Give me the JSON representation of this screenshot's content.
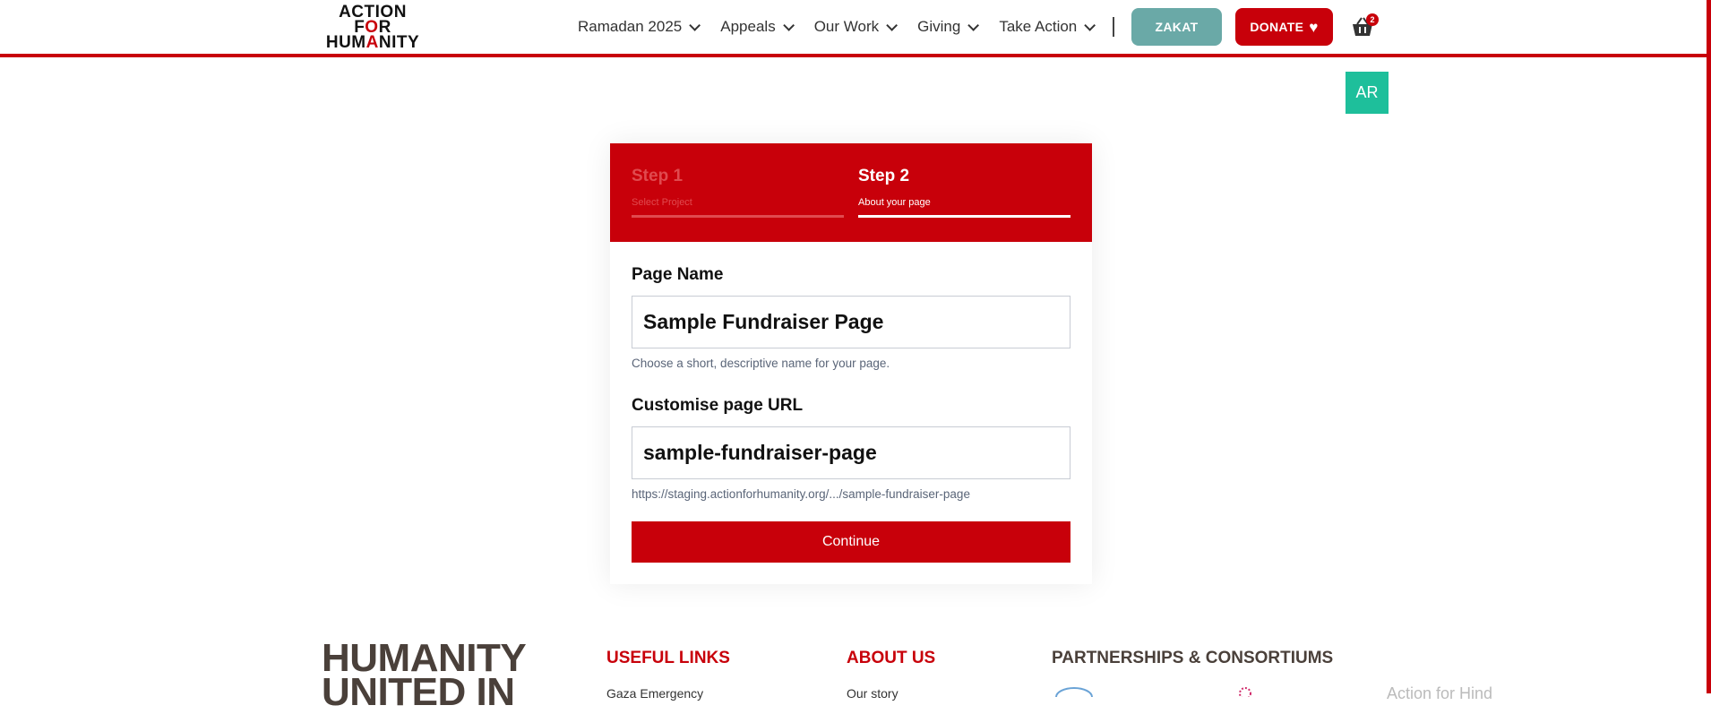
{
  "brand": {
    "logo_line1": "ACTI",
    "logo_line1_o": "O",
    "logo_line1_end": "N",
    "logo_line2": "F",
    "logo_line2_o": "O",
    "logo_line2_end": "R",
    "logo_line3_a": "HUM",
    "logo_line3_b": "A",
    "logo_line3_c": "NITY"
  },
  "nav": {
    "items": [
      {
        "label": "Ramadan 2025"
      },
      {
        "label": "Appeals"
      },
      {
        "label": "Our Work"
      },
      {
        "label": "Giving"
      },
      {
        "label": "Take Action"
      }
    ],
    "zakat_label": "ZAKAT",
    "donate_label": "DONATE",
    "cart_count": "2",
    "language_label": "AR"
  },
  "steps": [
    {
      "title": "Step 1",
      "subtitle": "Select Project",
      "state": "inactive"
    },
    {
      "title": "Step 2",
      "subtitle": "About your page",
      "state": "active"
    }
  ],
  "form": {
    "page_name_label": "Page Name",
    "page_name_value": "Sample Fundraiser Page",
    "page_name_help": "Choose a short, descriptive name for your page.",
    "url_label": "Customise page URL",
    "url_value": "sample-fundraiser-page",
    "url_help": "https://staging.actionforhumanity.org/.../sample-fundraiser-page",
    "continue_label": "Continue"
  },
  "footer": {
    "brand_line1": "HUMANITY",
    "brand_line2": "UNITED IN",
    "useful_links_heading": "USEFUL LINKS",
    "useful_links_first": "Gaza Emergency",
    "about_heading": "ABOUT US",
    "about_first": "Our story",
    "partners_heading": "PARTNERSHIPS & CONSORTIUMS",
    "partner_text": "Action for Hind"
  },
  "colors": {
    "brand_red": "#c8000a",
    "zakat_teal": "#6aa9a7",
    "lang_green": "#1ebf9b"
  }
}
